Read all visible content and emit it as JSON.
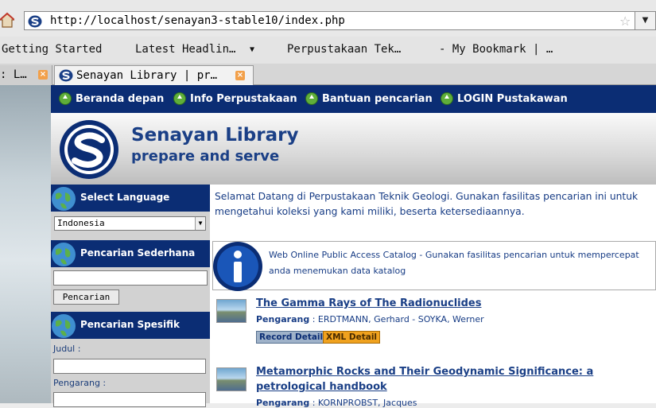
{
  "browser": {
    "url": "http://localhost/senayan3-stable10/index.php",
    "bookmarks": {
      "getting_started": "Getting Started",
      "latest_headlines": "Latest Headlin…",
      "perpustakaan": "Perpustakaan Tek…",
      "my_bookmark": "- My Bookmark | …"
    },
    "tabs": [
      {
        "label": ": L…"
      },
      {
        "label": "Senayan Library | pr…"
      }
    ],
    "icons": [
      "home-icon",
      "star-icon",
      "rss-icon",
      "senayan-favicon",
      "gdl-icon",
      "tab-close-icon"
    ]
  },
  "nav": {
    "items": [
      "Beranda depan",
      "Info Perpustakaan",
      "Bantuan pencarian",
      "LOGIN Pustakawan"
    ]
  },
  "banner": {
    "title": "Senayan Library",
    "subtitle": "prepare and serve"
  },
  "sidebar": {
    "language": {
      "heading": "Select Language",
      "selected": "Indonesia"
    },
    "simple_search": {
      "heading": "Pencarian Sederhana",
      "button": "Pencarian",
      "value": ""
    },
    "advanced_search": {
      "heading": "Pencarian Spesifik",
      "title_label": "Judul :",
      "author_label": "Pengarang :"
    }
  },
  "main": {
    "welcome": "Selamat Datang di Perpustakaan Teknik Geologi. Gunakan fasilitas pencarian ini untuk mengetahui koleksi yang kami miliki, beserta ketersediaannya.",
    "opac_info": "Web Online Public Access Catalog - Gunakan fasilitas pencarian untuk mempercepat anda menemukan data katalog",
    "books": [
      {
        "title": "The Gamma Rays of The Radionuclides",
        "author_label": "Pengarang",
        "authors": "ERDTMANN, Gerhard - SOYKA, Werner",
        "record_btn": "Record Detail",
        "xml_btn": "XML Detail"
      },
      {
        "title": "Metamorphic Rocks and Their Geodynamic Significance: a petrological handbook",
        "author_label": "Pengarang",
        "authors": "KORNPROBST, Jacques"
      }
    ]
  },
  "colors": {
    "nav_bg": "#0b2d74",
    "title_blue": "#1a3f86",
    "xml_orange": "#f0a21e"
  }
}
